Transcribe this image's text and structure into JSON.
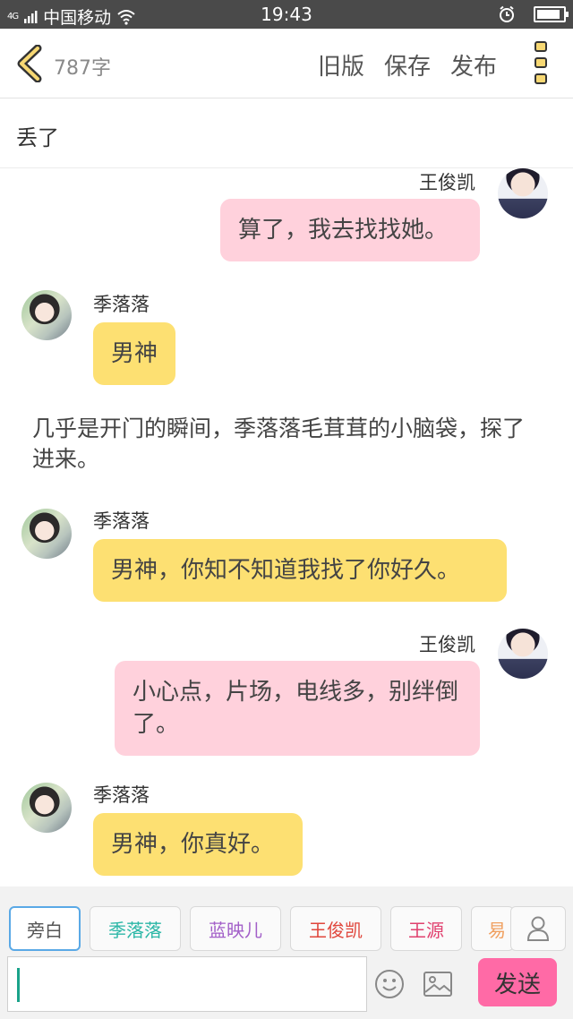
{
  "status_bar": {
    "signal_text": "4G",
    "carrier": "中国移动",
    "time": "19:43",
    "battery_level": 0.9
  },
  "toolbar": {
    "word_count": "787字",
    "old_version_label": "旧版",
    "save_label": "保存",
    "publish_label": "发布",
    "back_icon": "chevron-left-icon",
    "more_icon": "more-vertical-icon"
  },
  "title": "丢了",
  "messages": [
    {
      "type": "bubble",
      "side": "right",
      "speaker": "王俊凯",
      "text": "算了，我去找找她。",
      "color": "#ffd1dc"
    },
    {
      "type": "bubble",
      "side": "left",
      "speaker": "季落落",
      "text": "男神",
      "color": "#fde072"
    },
    {
      "type": "narration",
      "text": "几乎是开门的瞬间，季落落毛茸茸的小脑袋，探了进来。"
    },
    {
      "type": "bubble",
      "side": "left",
      "speaker": "季落落",
      "text": "男神，你知不知道我找了你好久。",
      "color": "#fde072"
    },
    {
      "type": "bubble",
      "side": "right",
      "speaker": "王俊凯",
      "text": "小心点，片场，电线多，别绊倒了。",
      "color": "#ffd1dc"
    },
    {
      "type": "bubble",
      "side": "left",
      "speaker": "季落落",
      "text": "男神，你真好。",
      "color": "#fde072"
    }
  ],
  "roles": [
    {
      "label": "旁白",
      "color": "#555555",
      "active": true
    },
    {
      "label": "季落落",
      "color": "#2cb7a7",
      "active": false
    },
    {
      "label": "蓝映儿",
      "color": "#a25fc8",
      "active": false
    },
    {
      "label": "王俊凯",
      "color": "#e0463c",
      "active": false
    },
    {
      "label": "王源",
      "color": "#e0406e",
      "active": false
    },
    {
      "label": "易",
      "color": "#f0a060",
      "active": false
    }
  ],
  "input": {
    "value": "",
    "send_label": "发送",
    "emoji_icon": "smile-icon",
    "image_icon": "image-icon",
    "user_icon": "user-icon"
  }
}
